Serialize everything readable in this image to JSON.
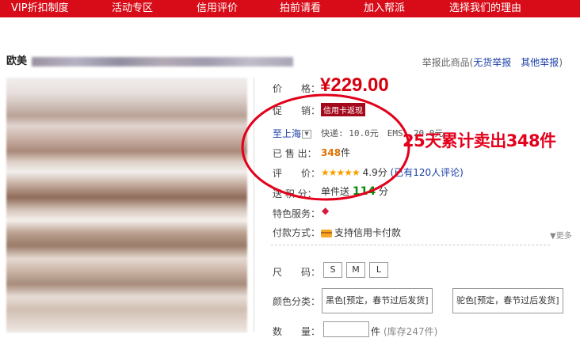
{
  "nav": [
    "VIP折扣制度",
    "活动专区",
    "信用评价",
    "拍前请看",
    "加入帮派",
    "选择我们的理由"
  ],
  "title": {
    "prefix": "欧美"
  },
  "report": {
    "label": "举报此商品",
    "open1": "(",
    "link1": "无货举报",
    "link2": "其他举报",
    "close": ")"
  },
  "labels": {
    "price": "价　　格：",
    "promo": "促　　销：",
    "ship_to": "至上海",
    "sold": "已 售 出：",
    "rating": "评　　价：",
    "points": "送 积 分：",
    "service": "特色服务：",
    "payment": "付款方式：",
    "size": "尺　　码：",
    "color": "颜色分类：",
    "qty": "数　　量："
  },
  "price": "¥229.00",
  "promo_badge": "信用卡返现",
  "shipping": {
    "express": "快递: 10.0元",
    "ems": "EMS: 20.0元"
  },
  "sold": {
    "count": "348",
    "unit": "件"
  },
  "rating": {
    "stars": "★★★★★",
    "score": "4.9分",
    "reviews": "(已有120人评论)"
  },
  "points": {
    "prefix": "单件送",
    "value": "114",
    "unit": "分"
  },
  "payment": "支持信用卡付款",
  "more": "▼更多",
  "sizes": [
    "S",
    "M",
    "L"
  ],
  "colors": [
    "黑色[预定，春节过后发货]",
    "驼色[预定，春节过后发货]"
  ],
  "qty": {
    "unit": "件",
    "stock": "(库存247件)"
  },
  "annotation": "25天累计卖出348件",
  "colors_theme": {
    "nav_bg": "#d80c18",
    "price": "#d7000f",
    "annotation": "#e3001b"
  }
}
